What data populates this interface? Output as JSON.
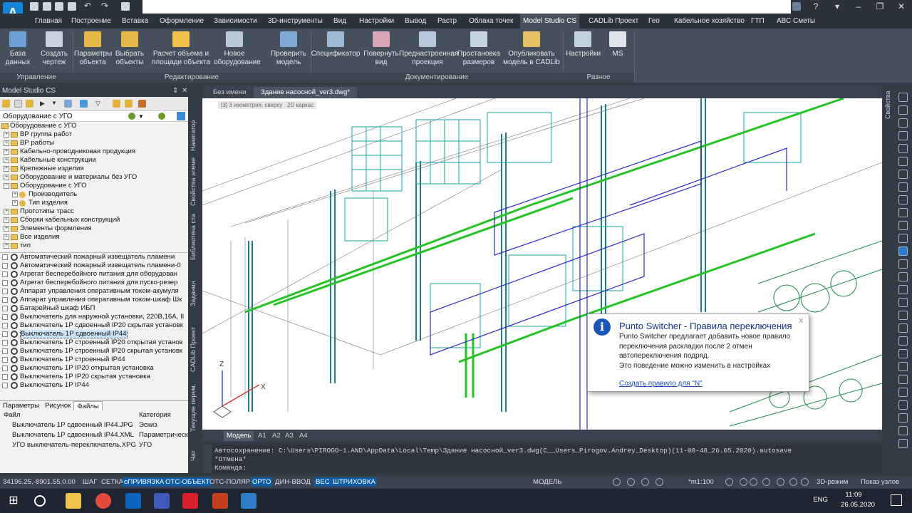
{
  "app": {
    "logo_letter": "A",
    "search_placeholder": ""
  },
  "ribbon_tabs": [
    "Главная",
    "Построение",
    "Вставка",
    "Оформление",
    "Зависимости",
    "3D-инструменты",
    "Вид",
    "Настройки",
    "Вывод",
    "Растр",
    "Облака точек",
    "Model Studio CS",
    "CADLib Проект",
    "Гео",
    "Кабельное хозяйство",
    "ГТП",
    "АВС Сметы"
  ],
  "active_tab": "Model Studio CS",
  "ribbon_buttons": [
    {
      "label1": "База",
      "label2": "данных",
      "icon": "database-icon"
    },
    {
      "label1": "Создать",
      "label2": "чертеж",
      "icon": "create-drawing-icon"
    },
    {
      "label1": "Параметры",
      "label2": "объекта",
      "icon": "object-params-icon"
    },
    {
      "label1": "Выбрать",
      "label2": "объекты",
      "icon": "select-objects-icon"
    },
    {
      "label1": "Расчет объема и",
      "label2": "площади объекта",
      "icon": "volume-area-icon"
    },
    {
      "label1": "Новое",
      "label2": "оборудование",
      "icon": "new-equipment-icon"
    },
    {
      "label1": "Проверить",
      "label2": "модель",
      "icon": "check-model-icon"
    },
    {
      "label1": "Спецификатор",
      "label2": "",
      "icon": "specificator-icon"
    },
    {
      "label1": "Повернуть",
      "label2": "вид",
      "icon": "rotate-view-icon"
    },
    {
      "label1": "Преднастроенная",
      "label2": "проекция",
      "icon": "projection-icon"
    },
    {
      "label1": "Простановка",
      "label2": "размеров",
      "icon": "dimensions-icon"
    },
    {
      "label1": "Опубликовать",
      "label2": "модель в CADLib",
      "icon": "publish-icon"
    },
    {
      "label1": "Настройки",
      "label2": "",
      "icon": "settings-icon"
    },
    {
      "label1": "MS",
      "label2": "",
      "icon": "ms-icon"
    }
  ],
  "ribbon_groups": [
    "Управление",
    "Редактирование",
    "Документирование",
    "Разное"
  ],
  "left_panel": {
    "title": "Model Studio CS",
    "combo": "Оборудование с УГО",
    "tree": [
      {
        "label": "ВР группа работ",
        "level": 0
      },
      {
        "label": "ВР работы",
        "level": 0
      },
      {
        "label": "Кабельно-проводниковая продукция",
        "level": 0
      },
      {
        "label": "Кабельные конструкции",
        "level": 0
      },
      {
        "label": "Крепежные изделия",
        "level": 0
      },
      {
        "label": "Оборудование и материалы без УГО",
        "level": 0
      },
      {
        "label": "Оборудование с УГО",
        "level": 0
      },
      {
        "label": "Производитель",
        "level": 1
      },
      {
        "label": "Тип изделия",
        "level": 1
      },
      {
        "label": "Прототипы трасс",
        "level": 0
      },
      {
        "label": "Сборки кабельных конструкций",
        "level": 0
      },
      {
        "label": "Элементы формления",
        "level": 0
      },
      {
        "label": "Все изделия",
        "level": 0
      },
      {
        "label": "тип",
        "level": 0
      }
    ],
    "list": [
      "Автоматический пожарный извещатель пламени",
      "Автоматический пожарный извещатель пламени-0",
      "Агрегат бесперебойного питания для оборудован",
      "Агрегат бесперебойного питания для пуско-резер",
      "Аппарат управления оперативным током-акумуля",
      "Аппарат управления оперативным током-шкаф Шк",
      "Батарейный шкаф ИБП",
      "Выключатель  для наружной установки, 220В,16А, II",
      "Выключатель 1Р сдвоенный IP20 скрытая установк",
      "Выключатель 1Р сдвоенный IP44",
      "Выключатель 1Р строенный IP20 открытая установ",
      "Выключатель 1Р строенный IP20 скрытая установк",
      "Выключатель 1Р строенный IP44",
      "Выключатель 1Р IP20 открытая установка",
      "Выключатель 1Р IP20 скрытая установка",
      "Выключатель 1Р IP44"
    ],
    "selected_index": 9,
    "bottom_tabs": [
      "Параметры",
      "Рисунок",
      "Файлы"
    ],
    "active_bottom_tab": "Файлы",
    "files_header": {
      "col1": "Файл",
      "col2": "Категория"
    },
    "files": [
      {
        "name": "Выключатель 1Р сдвоенный IP44.JPG",
        "cat": "Эскиз"
      },
      {
        "name": "Выключатель 1Р сдвоенный IP44.XML",
        "cat": "Параметрическ"
      },
      {
        "name": "УГО выключатель-переключатель.XPG",
        "cat": "УГО"
      }
    ]
  },
  "vertical_tabs": [
    "Навигатор",
    "Свойства элеме",
    "Библиотека ста",
    "Задания",
    "CADLib Проект",
    "Текущие перем.",
    "Чат"
  ],
  "doc_tabs": [
    "Без имени",
    "Здание насосной_ver3.dwg*"
  ],
  "view_labels": [
    "[3] 3 изометрия, сверху",
    "2D каркас"
  ],
  "compass_label": "",
  "axis": {
    "z": "Z",
    "x": "X"
  },
  "layout_tabs": [
    "Модель",
    "А1",
    "А2",
    "А3",
    "А4"
  ],
  "command": {
    "line1": "Автосохранение: C:\\Users\\PIROGO~1.AND\\AppData\\Local\\Temp\\Здание насосной_ver3.dwg(C__Users_Pirogov.Andrey_Desktop)(11-08-48_26.05.2020).autosave",
    "line2": "*Отмена*",
    "line3": "Команда:"
  },
  "status": {
    "coords": "34196.25,-8901.55,0.00",
    "toggles": [
      {
        "label": "ШАГ",
        "on": false
      },
      {
        "label": "СЕТКА",
        "on": false
      },
      {
        "label": "оПРИВЯЗКА",
        "on": true
      },
      {
        "label": "ОТС-ОБЪЕКТ",
        "on": true
      },
      {
        "label": "ОТС-ПОЛЯР",
        "on": false
      },
      {
        "label": "ОРТО",
        "on": true
      },
      {
        "label": "ДИН-ВВОД",
        "on": false
      },
      {
        "label": "ВЕС",
        "on": true
      },
      {
        "label": "ШТРИХОВКА",
        "on": true
      }
    ],
    "model": "МОДЕЛЬ",
    "scale": "*m1:100",
    "mode3d": "3D-режим",
    "show_nodes": "Показ узлов"
  },
  "popup": {
    "title": "Punto Switcher - Правила переключения",
    "message_lines": [
      "Punto Switcher предлагает добавить новое правило",
      "переключения раскладки после 2 отмен",
      "автопереключения подряд.",
      "Это поведение можно изменить в настройках"
    ],
    "link": "Создать правило для \"N\"",
    "close": "x"
  },
  "taskbar": {
    "lang": "ENG",
    "time": "11:09",
    "date": "26.05.2020"
  },
  "colors": {
    "accent": "#0e5ba3",
    "ribbon": "#46505c",
    "popup_title": "#16348f"
  }
}
